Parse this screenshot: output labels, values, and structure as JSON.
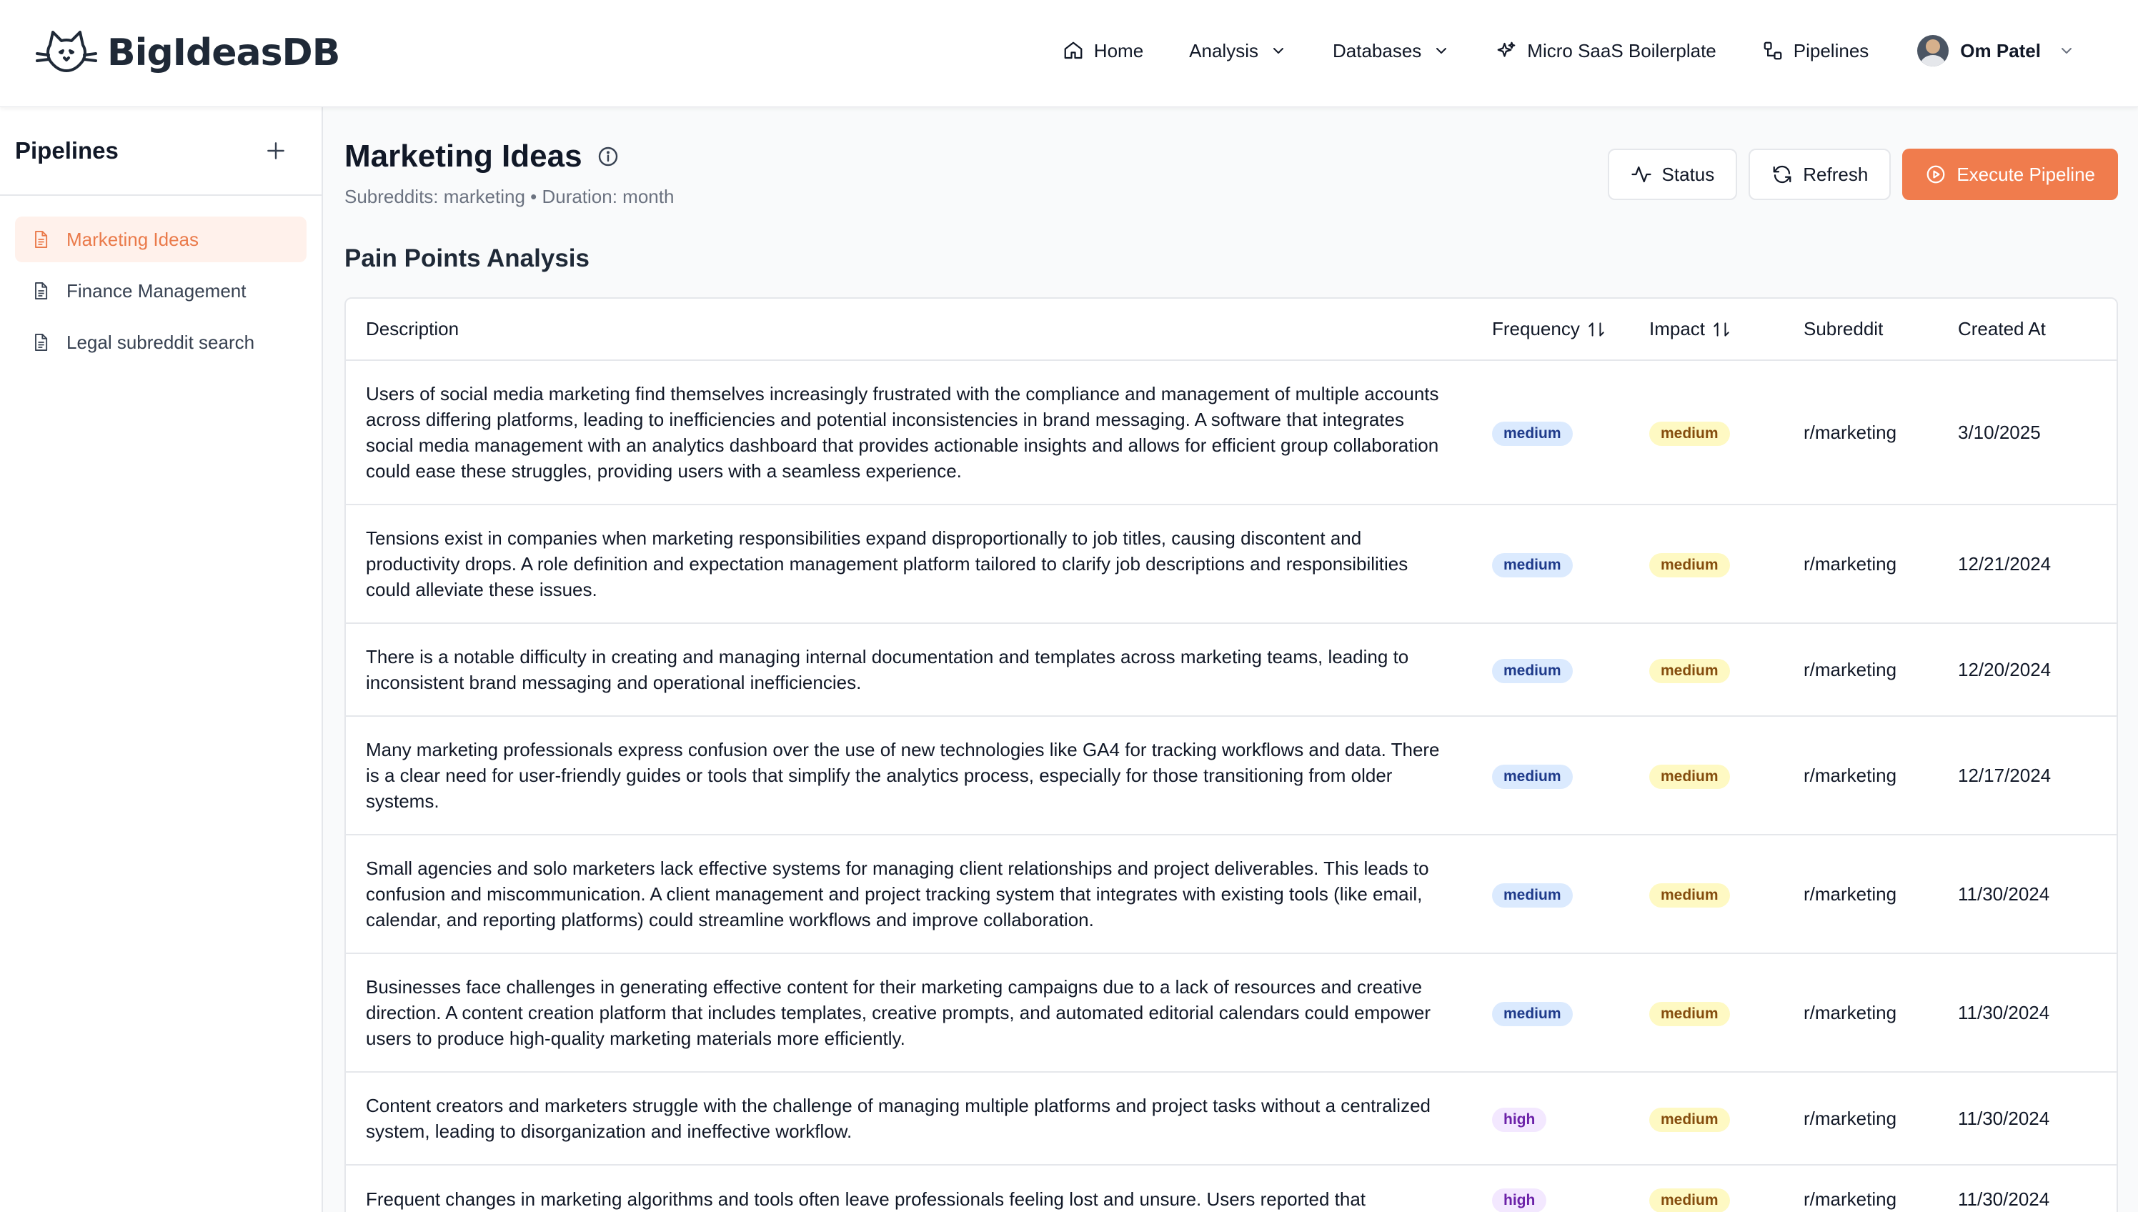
{
  "app": {
    "logo_text": "BigIdeasDB"
  },
  "nav": {
    "home": "Home",
    "analysis": "Analysis",
    "databases": "Databases",
    "micro_saas": "Micro SaaS Boilerplate",
    "pipelines": "Pipelines",
    "user_name": "Om Patel"
  },
  "sidebar": {
    "title": "Pipelines",
    "items": [
      {
        "label": "Marketing Ideas",
        "active": true
      },
      {
        "label": "Finance Management",
        "active": false
      },
      {
        "label": "Legal subreddit search",
        "active": false
      }
    ]
  },
  "page": {
    "title": "Marketing Ideas",
    "subtitle": "Subreddits: marketing • Duration: month",
    "section_title": "Pain Points Analysis"
  },
  "actions": {
    "status": "Status",
    "refresh": "Refresh",
    "execute": "Execute Pipeline"
  },
  "table": {
    "headers": {
      "description": "Description",
      "frequency": "Frequency",
      "impact": "Impact",
      "subreddit": "Subreddit",
      "created_at": "Created At"
    },
    "rows": [
      {
        "description": "Users of social media marketing find themselves increasingly frustrated with the compliance and management of multiple accounts across differing platforms, leading to inefficiencies and potential inconsistencies in brand messaging. A software that integrates social media management with an analytics dashboard that provides actionable insights and allows for efficient group collaboration could ease these struggles, providing users with a seamless experience.",
        "frequency": "medium",
        "impact": "medium",
        "subreddit": "r/marketing",
        "created_at": "3/10/2025"
      },
      {
        "description": "Tensions exist in companies when marketing responsibilities expand disproportionally to job titles, causing discontent and productivity drops. A role definition and expectation management platform tailored to clarify job descriptions and responsibilities could alleviate these issues.",
        "frequency": "medium",
        "impact": "medium",
        "subreddit": "r/marketing",
        "created_at": "12/21/2024"
      },
      {
        "description": "There is a notable difficulty in creating and managing internal documentation and templates across marketing teams, leading to inconsistent brand messaging and operational inefficiencies.",
        "frequency": "medium",
        "impact": "medium",
        "subreddit": "r/marketing",
        "created_at": "12/20/2024"
      },
      {
        "description": "Many marketing professionals express confusion over the use of new technologies like GA4 for tracking workflows and data. There is a clear need for user-friendly guides or tools that simplify the analytics process, especially for those transitioning from older systems.",
        "frequency": "medium",
        "impact": "medium",
        "subreddit": "r/marketing",
        "created_at": "12/17/2024"
      },
      {
        "description": "Small agencies and solo marketers lack effective systems for managing client relationships and project deliverables. This leads to confusion and miscommunication. A client management and project tracking system that integrates with existing tools (like email, calendar, and reporting platforms) could streamline workflows and improve collaboration.",
        "frequency": "medium",
        "impact": "medium",
        "subreddit": "r/marketing",
        "created_at": "11/30/2024"
      },
      {
        "description": "Businesses face challenges in generating effective content for their marketing campaigns due to a lack of resources and creative direction. A content creation platform that includes templates, creative prompts, and automated editorial calendars could empower users to produce high-quality marketing materials more efficiently.",
        "frequency": "medium",
        "impact": "medium",
        "subreddit": "r/marketing",
        "created_at": "11/30/2024"
      },
      {
        "description": "Content creators and marketers struggle with the challenge of managing multiple platforms and project tasks without a centralized system, leading to disorganization and ineffective workflow.",
        "frequency": "high",
        "impact": "medium",
        "subreddit": "r/marketing",
        "created_at": "11/30/2024"
      },
      {
        "description": "Frequent changes in marketing algorithms and tools often leave professionals feeling lost and unsure. Users reported that",
        "frequency": "high",
        "impact": "medium",
        "subreddit": "r/marketing",
        "created_at": "11/30/2024"
      }
    ]
  },
  "colors": {
    "accent": "#f07c4d",
    "active_bg": "#fff1eb",
    "active_text": "#ea7a4a"
  }
}
